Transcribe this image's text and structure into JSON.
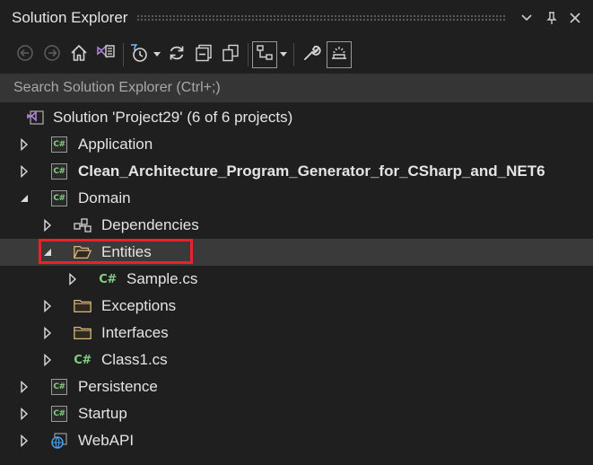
{
  "window": {
    "title": "Solution Explorer"
  },
  "toolbar": {
    "buttons": [
      {
        "icon": "back-icon",
        "enabled": false
      },
      {
        "icon": "forward-icon",
        "enabled": false
      },
      {
        "icon": "home-icon",
        "enabled": true
      },
      {
        "icon": "switch-views-icon",
        "enabled": true
      },
      {
        "icon": "pending-changes-filter-icon",
        "enabled": true
      },
      {
        "icon": "sync-icon",
        "enabled": true
      },
      {
        "icon": "collapse-all-icon",
        "enabled": true
      },
      {
        "icon": "show-all-files-icon",
        "enabled": true
      },
      {
        "icon": "class-view-icon",
        "enabled": true
      },
      {
        "icon": "properties-icon",
        "enabled": true
      },
      {
        "icon": "preview-selected-icon",
        "enabled": true
      }
    ]
  },
  "search": {
    "placeholder": "Search Solution Explorer (Ctrl+;)",
    "value": ""
  },
  "tree": {
    "solution": {
      "label": "Solution 'Project29' (6 of 6 projects)"
    },
    "items": [
      {
        "label": "Application",
        "kind": "csproj",
        "expanded": false
      },
      {
        "label": "Clean_Architecture_Program_Generator_for_CSharp_and_NET6",
        "kind": "csproj",
        "expanded": false,
        "bold": true
      },
      {
        "label": "Domain",
        "kind": "csproj",
        "expanded": true
      },
      {
        "label": "Dependencies",
        "kind": "dependencies",
        "expanded": false
      },
      {
        "label": "Entities",
        "kind": "folder-open",
        "expanded": true,
        "highlighted": true
      },
      {
        "label": "Sample.cs",
        "kind": "csfile",
        "expanded": false
      },
      {
        "label": "Exceptions",
        "kind": "folder",
        "expanded": false
      },
      {
        "label": "Interfaces",
        "kind": "folder",
        "expanded": false
      },
      {
        "label": "Class1.cs",
        "kind": "csfile",
        "expanded": false
      },
      {
        "label": "Persistence",
        "kind": "csproj",
        "expanded": false
      },
      {
        "label": "Startup",
        "kind": "csproj",
        "expanded": false
      },
      {
        "label": "WebAPI",
        "kind": "webproj",
        "expanded": false
      }
    ]
  },
  "icon_text": {
    "csharp": "C#"
  },
  "colors": {
    "background": "#1f1f1f",
    "search_background": "#353535",
    "highlight_border": "#e8212b",
    "csharp_green": "#7fd07f",
    "folder_yellow": "#dcb67a",
    "solution_purple": "#b180d7"
  }
}
